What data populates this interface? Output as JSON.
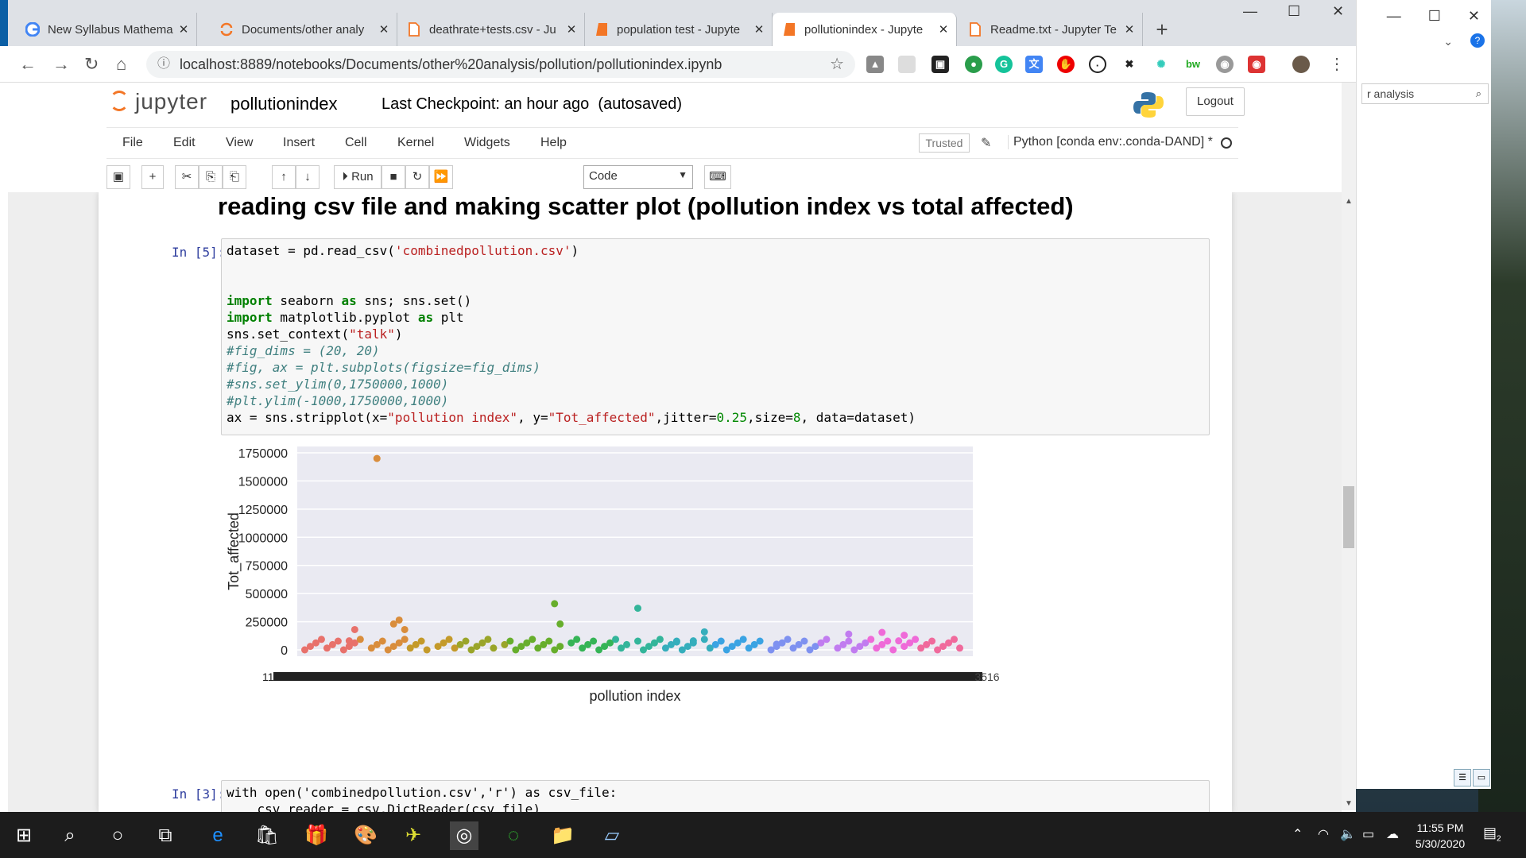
{
  "browser": {
    "tabs": [
      {
        "label": "New Syllabus Mathema",
        "icon": "google-icon",
        "active": false
      },
      {
        "label": "Documents/other analy",
        "icon": "jupyter-icon",
        "active": false
      },
      {
        "label": "deathrate+tests.csv - Ju",
        "icon": "file-icon",
        "active": false
      },
      {
        "label": "population test - Jupyte",
        "icon": "notebook-icon",
        "active": false
      },
      {
        "label": "pollutionindex - Jupyte",
        "icon": "notebook-icon",
        "active": true
      },
      {
        "label": "Readme.txt - Jupyter Te",
        "icon": "file-icon",
        "active": false
      }
    ],
    "url": "localhost:8889/notebooks/Documents/other%20analysis/pollution/pollutionindex.ipynb"
  },
  "second_window": {
    "search_text": "r analysis"
  },
  "jupyter": {
    "logo_text": "jupyter",
    "notebook_name": "pollutionindex",
    "checkpoint": "Last Checkpoint: an hour ago",
    "autosave": "(autosaved)",
    "logout_label": "Logout",
    "menu": [
      "File",
      "Edit",
      "View",
      "Insert",
      "Cell",
      "Kernel",
      "Widgets",
      "Help"
    ],
    "trusted_label": "Trusted",
    "kernel_label": "Python [conda env:.conda-DAND] *",
    "run_label": "Run",
    "cell_type": "Code"
  },
  "notebook": {
    "heading": "reading csv file and making scatter plot (pollution index vs total affected)",
    "cell1_prompt": "In [5]:",
    "cell2_prompt": "In [3]:",
    "cell2_line1": "with open('combinedpollution.csv','r') as csv_file:",
    "cell2_line2": "    csv_reader = csv.DictReader(csv_file)"
  },
  "chart_data": {
    "type": "scatter",
    "xlabel": "pollution index",
    "ylabel": "Tot_affected",
    "ylim": [
      0,
      1750000
    ],
    "yticks": [
      "0",
      "250000",
      "500000",
      "750000",
      "1000000",
      "1250000",
      "1500000",
      "1750000"
    ],
    "xtick_text_left": "111",
    "xtick_text_right": "3516",
    "grid": true,
    "x_category_count": 120,
    "points": [
      {
        "cat": 13,
        "y": 1700000
      },
      {
        "cat": 9,
        "y": 180000
      },
      {
        "cat": 8,
        "y": 80000
      },
      {
        "cat": 16,
        "y": 230000
      },
      {
        "cat": 17,
        "y": 265000
      },
      {
        "cat": 18,
        "y": 180000
      },
      {
        "cat": 45,
        "y": 410000
      },
      {
        "cat": 46,
        "y": 230000
      },
      {
        "cat": 60,
        "y": 370000
      },
      {
        "cat": 72,
        "y": 160000
      },
      {
        "cat": 67,
        "y": 70000
      },
      {
        "cat": 70,
        "y": 80000
      },
      {
        "cat": 98,
        "y": 140000
      },
      {
        "cat": 104,
        "y": 155000
      },
      {
        "cat": 107,
        "y": 80000
      },
      {
        "cat": 108,
        "y": 130000
      },
      {
        "cat": 85,
        "y": 50000
      }
    ],
    "baseline_count": 110
  },
  "taskbar": {
    "time": "11:55 PM",
    "date": "5/30/2020",
    "notif_count": "2"
  }
}
